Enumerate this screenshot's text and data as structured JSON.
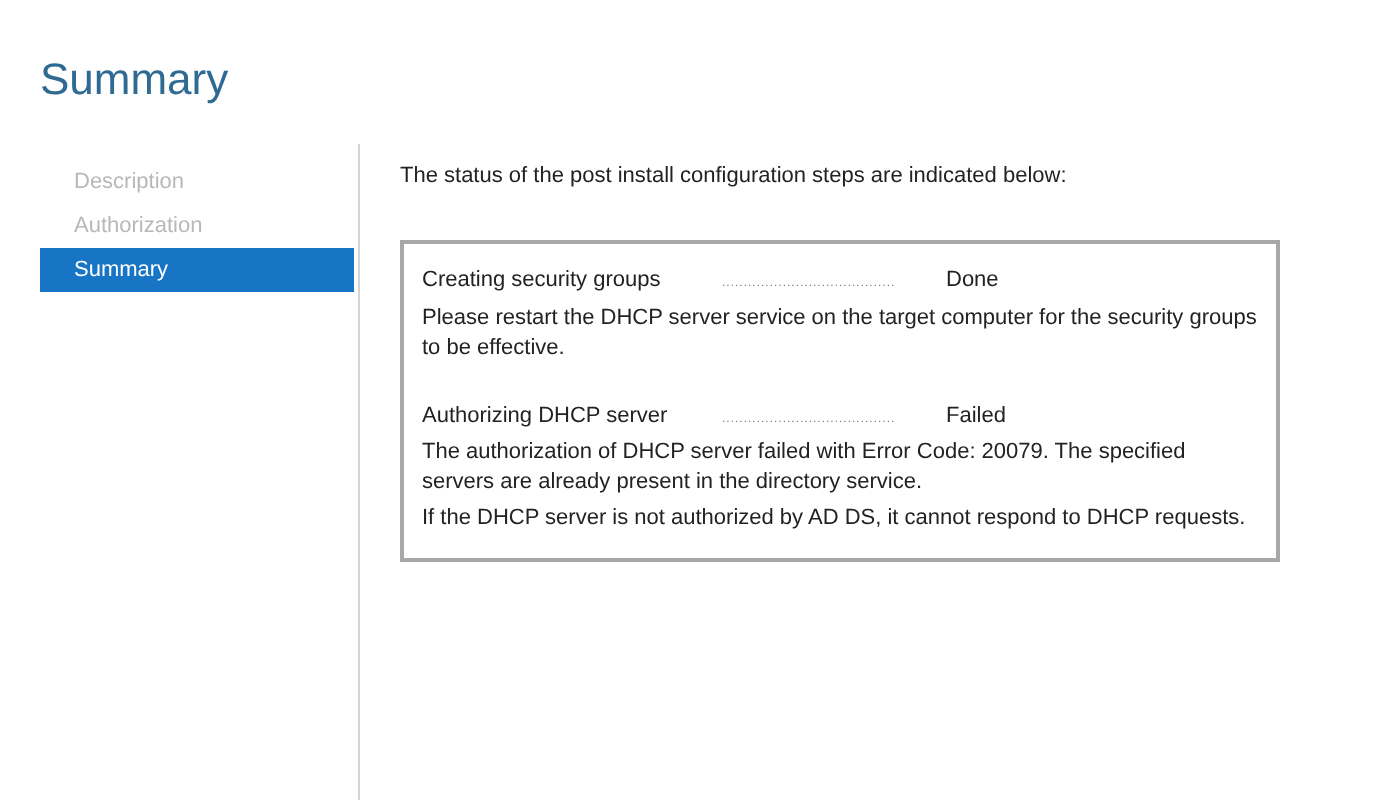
{
  "page": {
    "title": "Summary"
  },
  "sidebar": {
    "items": [
      {
        "label": "Description",
        "selected": false
      },
      {
        "label": "Authorization",
        "selected": false
      },
      {
        "label": "Summary",
        "selected": true
      }
    ]
  },
  "content": {
    "intro": "The status of the post install configuration steps are indicated below:",
    "steps": [
      {
        "name": "Creating security groups",
        "leader": "........................................",
        "status": "Done",
        "messages": [
          "Please restart the DHCP server service on the target computer for the security groups to be effective."
        ]
      },
      {
        "name": "Authorizing DHCP server",
        "leader": "........................................",
        "status": "Failed",
        "messages": [
          "The authorization of DHCP server failed with Error Code: 20079. The specified servers are already present in the directory service.",
          "If the DHCP server is not authorized by AD DS, it cannot respond to DHCP requests."
        ]
      }
    ]
  }
}
